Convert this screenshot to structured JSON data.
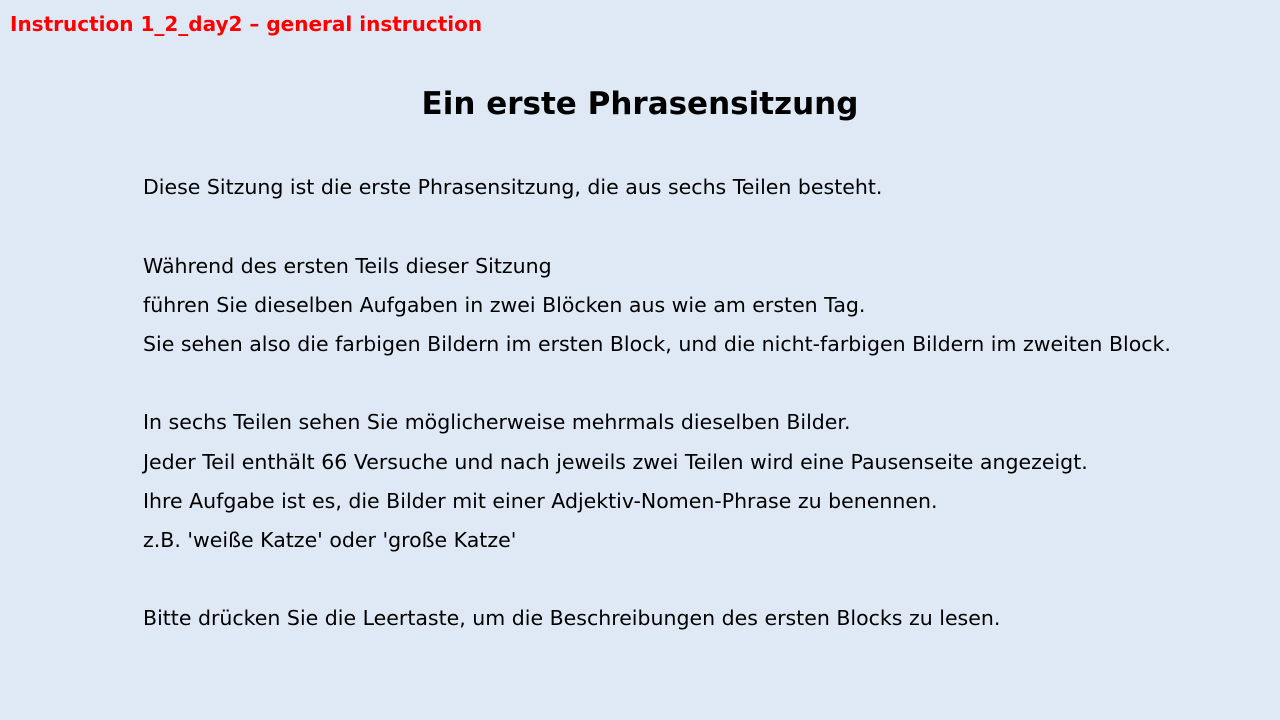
{
  "header": {
    "label": "Instruction 1_2_day2 – general instruction"
  },
  "main": {
    "title": "Ein erste Phrasensitzung",
    "lines": [
      "Diese Sitzung ist die erste Phrasensitzung, die aus sechs Teilen besteht.",
      "Während des ersten Teils dieser Sitzung",
      "führen Sie dieselben Aufgaben in zwei Blöcken aus wie am ersten Tag.",
      "Sie sehen also die farbigen Bildern im ersten Block, und die nicht-farbigen Bildern im zweiten Block.",
      "In sechs Teilen sehen Sie möglicherweise mehrmals dieselben Bilder.",
      "Jeder Teil enthält 66 Versuche und nach jeweils zwei Teilen wird eine Pausenseite angezeigt.",
      "Ihre Aufgabe ist es, die Bilder mit einer Adjektiv-Nomen-Phrase zu benennen.",
      "z.B. 'weiße Katze' oder 'große Katze'",
      "Bitte drücken Sie die Leertaste, um die Beschreibungen des ersten Blocks zu lesen."
    ]
  }
}
